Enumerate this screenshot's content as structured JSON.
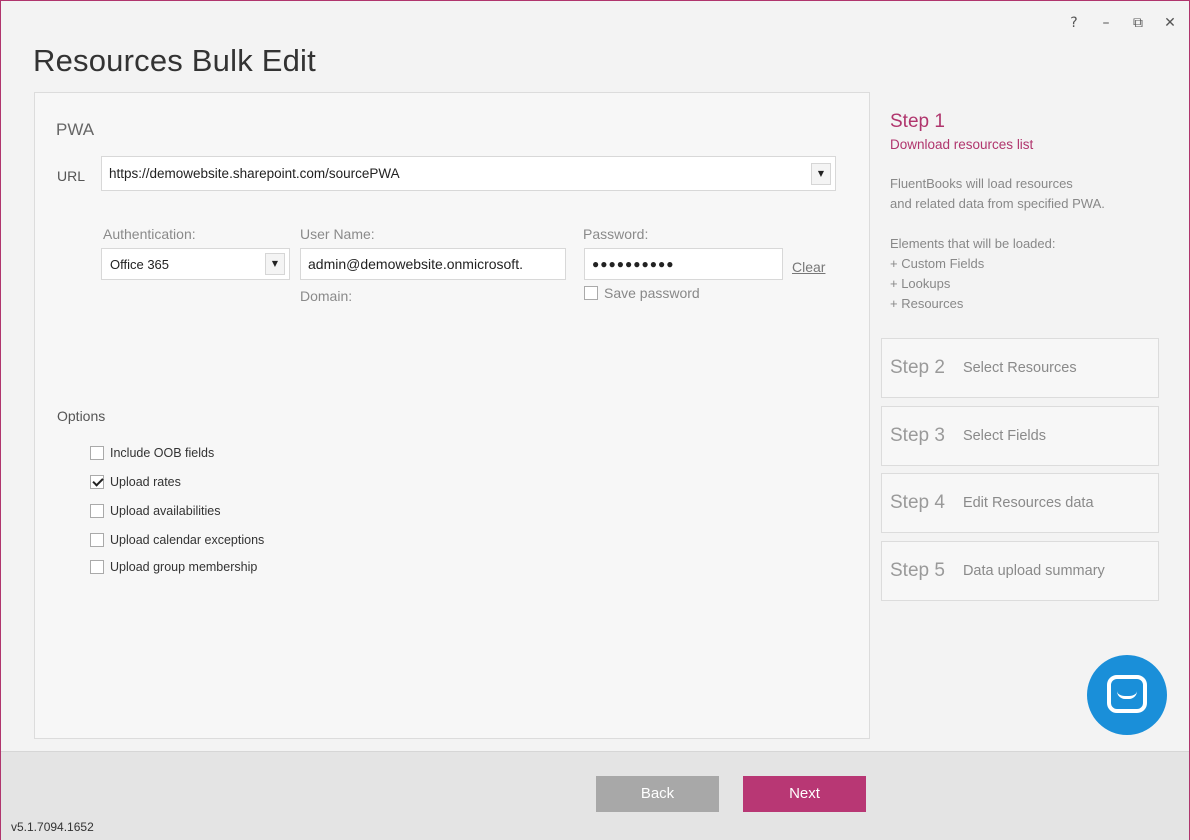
{
  "window": {
    "controls": {
      "help": "?",
      "minimize": "–",
      "restore": "⧉",
      "close": "✕"
    },
    "title": "Resources Bulk Edit",
    "accent_color": "#b0356d"
  },
  "pwa": {
    "section_title": "PWA",
    "url_label": "URL",
    "url_value": "https://demowebsite.sharepoint.com/sourcePWA",
    "auth_label": "Authentication:",
    "auth_value": "Office 365",
    "username_label": "User Name:",
    "username_value": "admin@demowebsite.onmicrosoft.",
    "domain_label": "Domain:",
    "password_label": "Password:",
    "password_value": "●●●●●●●●●●",
    "clear_label": "Clear",
    "save_password_label": "Save password",
    "save_password_checked": false
  },
  "options": {
    "title": "Options",
    "items": [
      {
        "label": "Include OOB fields",
        "checked": false
      },
      {
        "label": "Upload rates",
        "checked": true
      },
      {
        "label": "Upload availabilities",
        "checked": false
      },
      {
        "label": "Upload calendar exceptions",
        "checked": false
      },
      {
        "label": "Upload group membership",
        "checked": false
      }
    ]
  },
  "steps": {
    "step1": {
      "title": "Step 1",
      "subtitle": "Download resources list",
      "desc_line1": "FluentBooks will load resources",
      "desc_line2": "and related data from specified PWA.",
      "elements_title": "Elements that will be loaded:",
      "elements": [
        "+ Custom Fields",
        "+ Lookups",
        "+ Resources"
      ]
    },
    "others": [
      {
        "num": "Step 2",
        "label": "Select Resources"
      },
      {
        "num": "Step 3",
        "label": "Select Fields"
      },
      {
        "num": "Step 4",
        "label": "Edit Resources data"
      },
      {
        "num": "Step 5",
        "label": "Data upload summary"
      }
    ]
  },
  "footer": {
    "back_label": "Back",
    "next_label": "Next",
    "version": "v5.1.7094.1652"
  }
}
